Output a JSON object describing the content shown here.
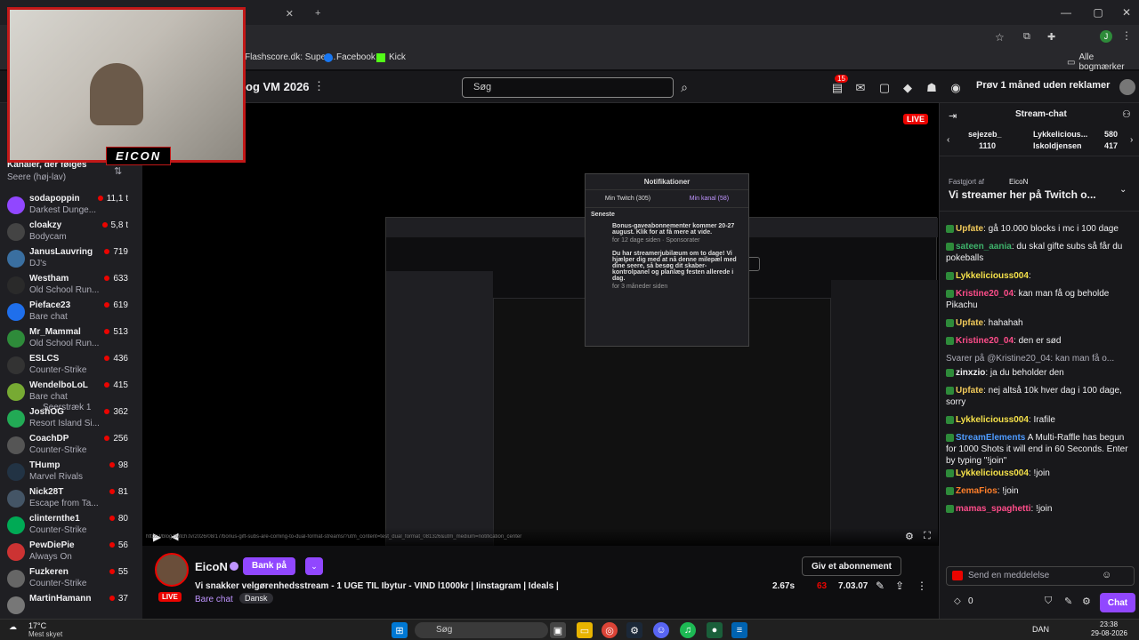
{
  "browser": {
    "tabs": [
      {
        "label": ""
      },
      {
        "label": ""
      }
    ],
    "bookmarks": [
      {
        "label": "Flashscore.dk: Super..."
      },
      {
        "label": "Facebook"
      },
      {
        "label": "Kick"
      }
    ],
    "all_bookmarks": "Alle bogmærker",
    "profile_initial": "J"
  },
  "topnav": {
    "page_title": "og VM 2026",
    "search_placeholder": "Søg",
    "notif_count": "15",
    "prime_label": "Prøv 1 måned uden reklamer"
  },
  "sidebar": {
    "header": "Kanaler, der følges",
    "sort": "Seere (høj-lav)",
    "channels": [
      {
        "name": "sodapoppin",
        "game": "Darkest Dunge...",
        "viewers": "11,1 t"
      },
      {
        "name": "cloakzy",
        "game": "Bodycam",
        "viewers": "5,8 t"
      },
      {
        "name": "JanusLauvring",
        "game": "DJ's",
        "viewers": "719"
      },
      {
        "name": "Westham",
        "game": "Old School Run...",
        "viewers": "633"
      },
      {
        "name": "Pieface23",
        "game": "Bare chat",
        "viewers": "619"
      },
      {
        "name": "Mr_Mammal",
        "game": "Old School Run...",
        "viewers": "513"
      },
      {
        "name": "ESLCS",
        "game": "Counter-Strike",
        "viewers": "436"
      },
      {
        "name": "WendelboLoL",
        "game": "Bare chat",
        "viewers": "415",
        "extra": "Seerstræk 1"
      },
      {
        "name": "JoshOG",
        "game": "Resort Island Si...",
        "viewers": "362"
      },
      {
        "name": "CoachDP",
        "game": "Counter-Strike",
        "viewers": "256"
      },
      {
        "name": "THump",
        "game": "Marvel Rivals",
        "viewers": "98"
      },
      {
        "name": "Nick28T",
        "game": "Escape from Ta...",
        "viewers": "81"
      },
      {
        "name": "clinternthe1",
        "game": "Counter-Strike",
        "viewers": "80"
      },
      {
        "name": "PewDiePie",
        "game": "Always On",
        "viewers": "56"
      },
      {
        "name": "Fuzkeren",
        "game": "Counter-Strike",
        "viewers": "55"
      },
      {
        "name": "MartinHamann",
        "game": "",
        "viewers": "37"
      }
    ]
  },
  "video": {
    "overlay_tag": "EICON",
    "url_hint": "https://blog.twitch.tv/2026/08/17/bonus-gift-subs-are-coming-to-dual-format-streams/?utm_content=test_dual_format_081326&utm_medium=notification_center",
    "notifications": {
      "title": "Notifikationer",
      "tab1": "Min Twitch (305)",
      "tab2": "Min kanal (58)",
      "section": "Seneste",
      "item1": "Bonus-gaveabonnementer kommer 20-27 august. Klik for at få mere at vide.",
      "item1_meta": "for 12 dage siden · Sponsorater",
      "item2": "Du har streamerjubilæum om to dage! Vi hjælper dig med at nå denne milepæl med dine seere, så besøg dit skaber-kontrolpanel og planlæg festen allerede i dag.",
      "item2_meta": "for 3 måneder siden"
    }
  },
  "stream": {
    "channel": "EicoN",
    "support_button": "Bank på",
    "title": "Vi snakker velgørenhedsstream - 1 UGE TIL Ibytur - VIND l1000kr | Iinstagram | Ideals |",
    "category": "Bare chat",
    "tag": "Dansk",
    "live": "LIVE",
    "subscribe": "Giv et abonnement",
    "viewers": "2.67s",
    "hearts": "63",
    "uptime": "7.03.07"
  },
  "chat": {
    "header": "Stream-chat",
    "gifters": [
      {
        "name": "sejezeb_",
        "count": "1110"
      },
      {
        "name": "Lykkelicious...",
        "count": "580"
      },
      {
        "name": "Iskoldjensen",
        "count": "417"
      }
    ],
    "pinned_by": "Fastgjort af",
    "pinned_user": "EicoN",
    "pinned_msg": "Vi streamer her på Twitch o...",
    "messages": [
      {
        "user": "Upfate",
        "text": ": gå 10.000 blocks i mc i 100 dage",
        "color": "#f0c95a"
      },
      {
        "user": "sateen_aania",
        "text": ": du skal gifte subs så får du pokeballs",
        "color": "#3eb36b"
      },
      {
        "user": "Lykkeliciouss004",
        "text": ":",
        "color": "#f5e14a"
      },
      {
        "user": "Kristine20_04",
        "text": ": kan man få og beholde Pikachu",
        "color": "#ff4d8a"
      },
      {
        "user": "Upfate",
        "text": ": hahahah",
        "color": "#f0c95a"
      },
      {
        "user": "Kristine20_04",
        "text": ": den er sød",
        "color": "#ff4d8a"
      },
      {
        "user": "",
        "text": "Svarer på @Kristine20_04: kan man få o...",
        "color": "#adadb8"
      },
      {
        "user": "zinxzio",
        "text": ": ja du beholder den",
        "color": "#efeff1"
      },
      {
        "user": "Upfate",
        "text": ": nej altså 10k hver dag i 100 dage, sorry",
        "color": "#f0c95a"
      },
      {
        "user": "Lykkeliciouss004",
        "text": ": Irafile",
        "color": "#f5e14a"
      },
      {
        "user": "StreamElements",
        "text": " A Multi-Raffle has begun for 1000 Shots it will end in 60 Seconds. Enter by typing \"!join\"",
        "color": "#4e9bff"
      },
      {
        "user": "Lykkeliciouss004",
        "text": ": !join",
        "color": "#f5e14a"
      },
      {
        "user": "ZemaFios",
        "text": ": !join",
        "color": "#ff7f2a"
      },
      {
        "user": "mamas_spaghetti",
        "text": ": !join",
        "color": "#ff4d8a"
      }
    ],
    "input_placeholder": "Send en meddelelse",
    "points": "0",
    "chat_button": "Chat"
  },
  "taskbar": {
    "weather_temp": "17°C",
    "weather_text": "Mest skyet",
    "search": "Søg",
    "lang": "DAN",
    "time": "23:38",
    "date": "29-08-2026"
  }
}
